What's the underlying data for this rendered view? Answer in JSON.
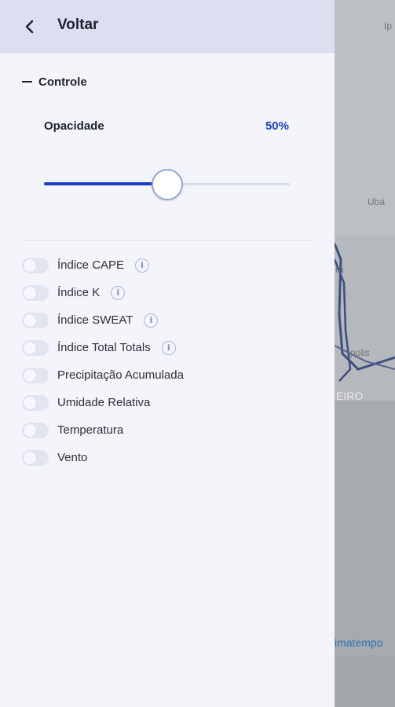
{
  "header": {
    "title": "Voltar"
  },
  "controls": {
    "section_label": "Controle",
    "opacity_label": "Opacidade",
    "opacity_value": "50%",
    "opacity_fraction": 0.5
  },
  "layers": [
    {
      "label": "Índice CAPE",
      "info": true,
      "enabled": false
    },
    {
      "label": "Índice K",
      "info": true,
      "enabled": false
    },
    {
      "label": "Índice SWEAT",
      "info": true,
      "enabled": false
    },
    {
      "label": "Índice Total Totals",
      "info": true,
      "enabled": false
    },
    {
      "label": "Precipitação Acumulada",
      "info": false,
      "enabled": false
    },
    {
      "label": "Umidade Relativa",
      "info": false,
      "enabled": false
    },
    {
      "label": "Temperatura",
      "info": false,
      "enabled": false
    },
    {
      "label": "Vento",
      "info": false,
      "enabled": false
    }
  ],
  "map": {
    "labels": [
      "Ip",
      "Ubá",
      "ra",
      "polis",
      "EIRO"
    ],
    "attribution": "imatempo"
  },
  "colors": {
    "accent": "#1c3fc7",
    "header_bg": "#dcdff0",
    "drawer_bg": "#f4f5fa"
  }
}
